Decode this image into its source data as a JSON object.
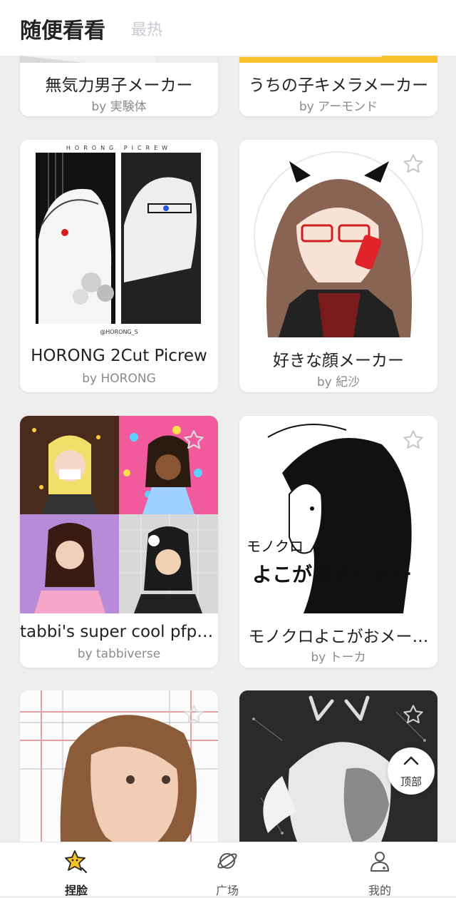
{
  "header": {
    "title": "随便看看",
    "tab_hot": "最热"
  },
  "cards": [
    {
      "name": "無気力男子メーカー",
      "author": "by 実験体"
    },
    {
      "name": "うちの子キメラメーカー",
      "author": "by アーモンド"
    },
    {
      "name": "HORONG 2Cut Picrew",
      "author": "by HORONG",
      "thumb_top_text": "HORONG PICREW",
      "thumb_bottom_text": "@HORONG_S"
    },
    {
      "name": "好きな顔メーカー",
      "author": "by 紀沙"
    },
    {
      "name": "tabbi's super cool pfp …",
      "author": "by tabbiverse"
    },
    {
      "name": "モノクロよこがおメー…",
      "author": "by トーカ",
      "thumb_line1": "モノクロ",
      "thumb_line2": "よこがおメーカー"
    },
    {
      "name": "",
      "author": ""
    },
    {
      "name": "",
      "author": ""
    }
  ],
  "to_top_label": "顶部",
  "nav": [
    {
      "label": "捏脸",
      "icon": "star-face-icon",
      "active": true
    },
    {
      "label": "广场",
      "icon": "planet-icon",
      "active": false
    },
    {
      "label": "我的",
      "icon": "user-icon",
      "active": false
    }
  ],
  "colors": {
    "accent_yellow": "#f6c12a",
    "text_dark": "#222222",
    "text_muted": "#8a8a8a"
  }
}
